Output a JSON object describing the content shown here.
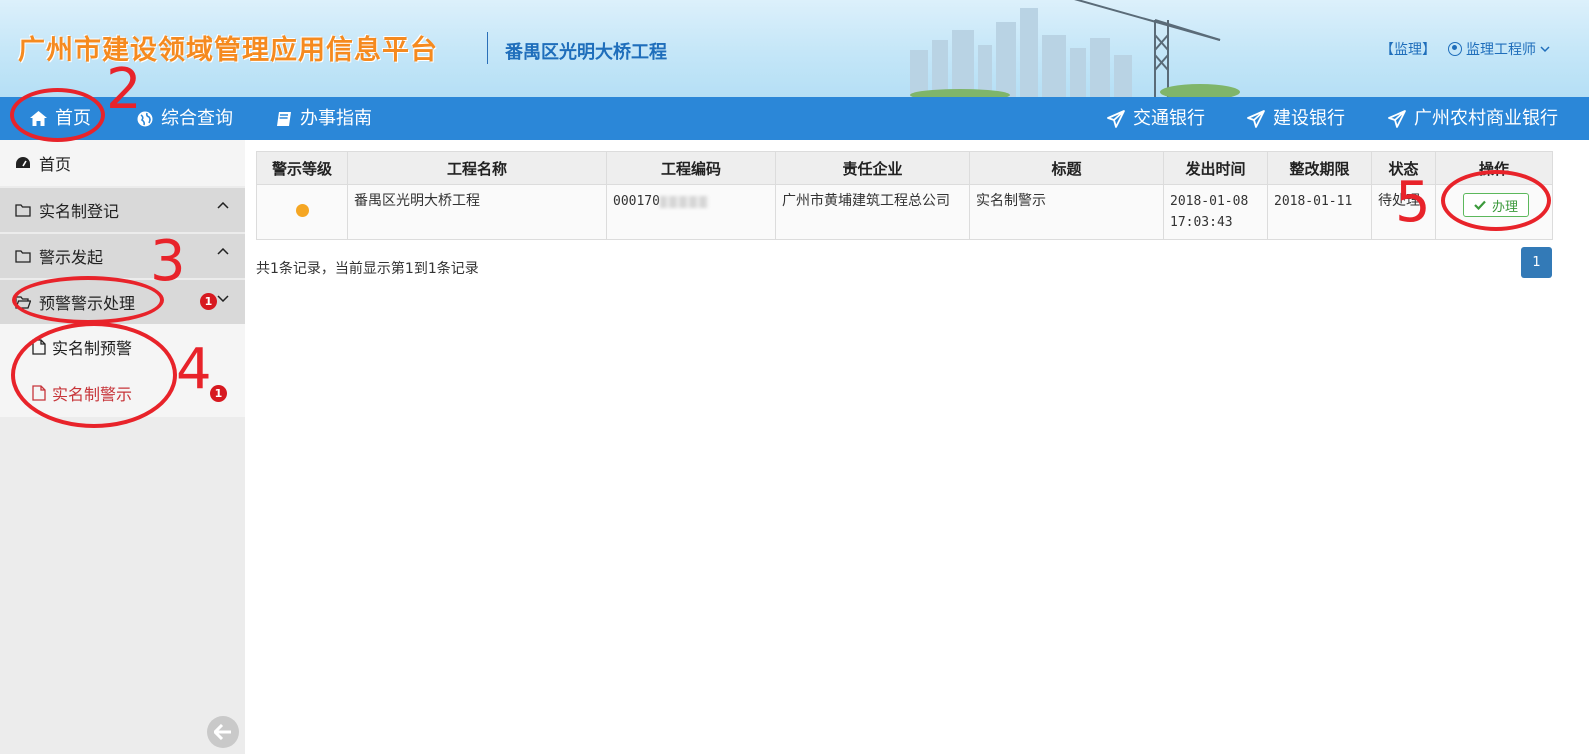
{
  "header": {
    "platform_title": "广州市建设领域管理应用信息平台",
    "project_title": "番禺区光明大桥工程",
    "user_role": "【监理】",
    "user_name": "监理工程师"
  },
  "navbar": {
    "left": [
      {
        "label": "首页",
        "icon": "home-icon"
      },
      {
        "label": "综合查询",
        "icon": "globe-icon"
      },
      {
        "label": "办事指南",
        "icon": "book-icon"
      }
    ],
    "right": [
      {
        "label": "交通银行",
        "icon": "send-icon"
      },
      {
        "label": "建设银行",
        "icon": "send-icon"
      },
      {
        "label": "广州农村商业银行",
        "icon": "send-icon"
      }
    ]
  },
  "sidebar": {
    "home": "首页",
    "groups": [
      {
        "label": "实名制登记"
      },
      {
        "label": "警示发起"
      },
      {
        "label": "预警警示处理",
        "badge": "1"
      }
    ],
    "subitems": [
      {
        "label": "实名制预警"
      },
      {
        "label": "实名制警示",
        "badge": "1"
      }
    ]
  },
  "table": {
    "columns": [
      "警示等级",
      "工程名称",
      "工程编码",
      "责任企业",
      "标题",
      "发出时间",
      "整改期限",
      "状态",
      "操作"
    ],
    "rows": [
      {
        "level_color": "#f5a623",
        "project_name": "番禺区光明大桥工程",
        "project_code": "000170",
        "company": "广州市黄埔建筑工程总公司",
        "title": "实名制警示",
        "issued_time": "2018-01-08 17:03:43",
        "deadline": "2018-01-11",
        "status": "待处理",
        "action": "办理"
      }
    ]
  },
  "summary": "共1条记录，当前显示第1到1条记录",
  "pagination": {
    "current": "1"
  },
  "annotations": [
    "2",
    "3",
    "4",
    "5"
  ],
  "colors": {
    "nav": "#2b87d8",
    "accent_red": "#e8232a",
    "warning": "#f5a623"
  }
}
